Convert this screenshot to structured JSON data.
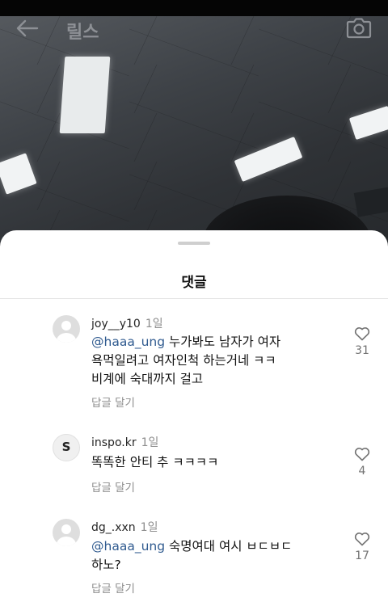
{
  "header": {
    "title": "릴스",
    "back_icon": "arrow-left-icon",
    "camera_icon": "camera-icon"
  },
  "comments_panel": {
    "title": "댓글",
    "comments": [
      {
        "username": "joy__y10",
        "time": "1일",
        "mention": "@haaa_ung",
        "text_line1": " 누가봐도 남자가 여자",
        "text_line2": "욕먹일려고 여자인척 하는거네 ㅋㅋ",
        "text_line3": "비계에 숙대까지 걸고",
        "reply_label": "답글 달기",
        "likes": "31",
        "avatar": "default-avatar"
      },
      {
        "username": "inspo.kr",
        "time": "1일",
        "avatar_glyph": "S",
        "text_line1": "똑똑한 안티 추 ㅋㅋㅋㅋ",
        "reply_label": "답글 달기",
        "likes": "4",
        "avatar": "brand-avatar"
      },
      {
        "username": "dg_.xxn",
        "time": "1일",
        "mention": "@haaa_ung",
        "text_line1": " 숙명여대 여시 ㅂㄷㅂㄷ",
        "text_line2": "하노?",
        "reply_label": "답글 달기",
        "likes": "17",
        "avatar": "default-avatar"
      }
    ]
  },
  "colors": {
    "mention": "#2f5a8f",
    "sheet_bg": "#ffffff",
    "muted": "#8e8e8e"
  }
}
